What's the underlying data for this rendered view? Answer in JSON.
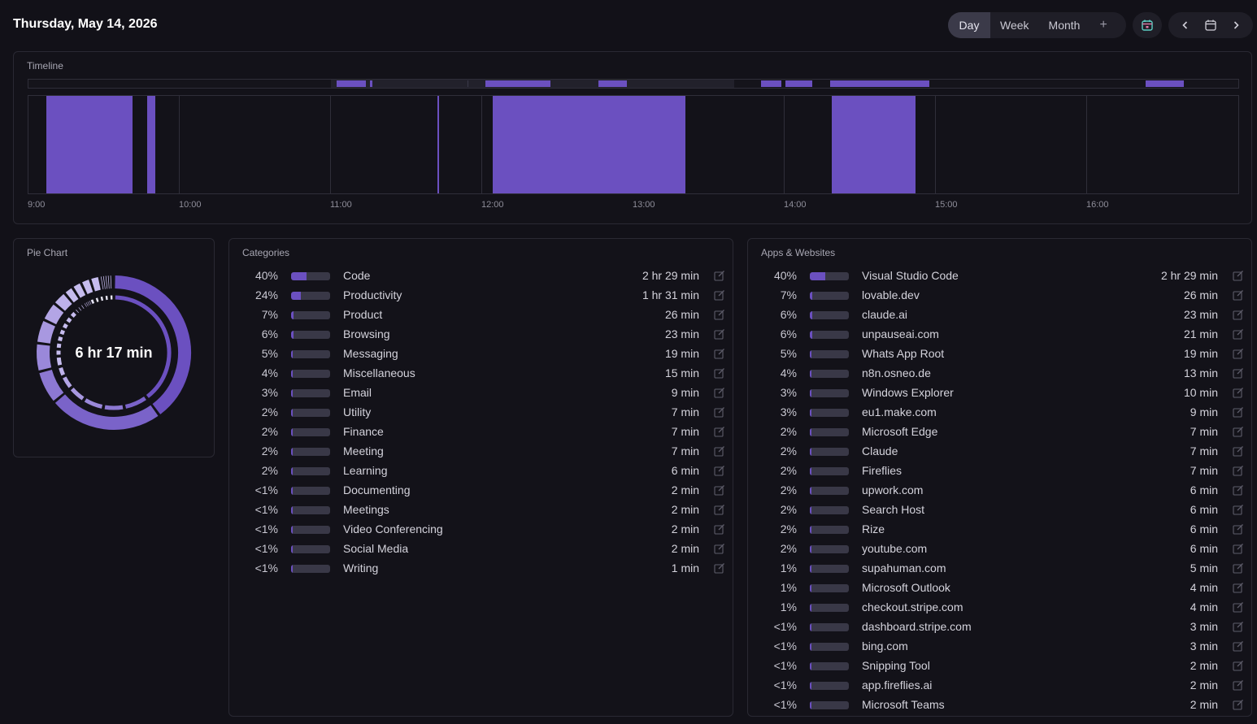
{
  "header": {
    "date": "Thursday, May 14, 2026",
    "ranges": [
      "Day",
      "Week",
      "Month"
    ],
    "active_range": "Day",
    "add_label": "+"
  },
  "colors": {
    "accent": "#6b50c0",
    "background": "#121118",
    "panel_border": "#2a2933"
  },
  "timeline": {
    "title": "Timeline",
    "ticks": [
      "9:00",
      "10:00",
      "11:00",
      "12:00",
      "13:00",
      "14:00",
      "15:00",
      "16:00"
    ]
  },
  "pie": {
    "title": "Pie Chart",
    "total": "6 hr 17 min"
  },
  "categories": {
    "title": "Categories",
    "items": [
      {
        "pct": "40%",
        "share": 0.4,
        "name": "Code",
        "duration": "2 hr 29 min"
      },
      {
        "pct": "24%",
        "share": 0.24,
        "name": "Productivity",
        "duration": "1 hr 31 min"
      },
      {
        "pct": "7%",
        "share": 0.07,
        "name": "Product",
        "duration": "26 min"
      },
      {
        "pct": "6%",
        "share": 0.06,
        "name": "Browsing",
        "duration": "23 min"
      },
      {
        "pct": "5%",
        "share": 0.05,
        "name": "Messaging",
        "duration": "19 min"
      },
      {
        "pct": "4%",
        "share": 0.04,
        "name": "Miscellaneous",
        "duration": "15 min"
      },
      {
        "pct": "3%",
        "share": 0.03,
        "name": "Email",
        "duration": "9 min"
      },
      {
        "pct": "2%",
        "share": 0.02,
        "name": "Utility",
        "duration": "7 min"
      },
      {
        "pct": "2%",
        "share": 0.02,
        "name": "Finance",
        "duration": "7 min"
      },
      {
        "pct": "2%",
        "share": 0.02,
        "name": "Meeting",
        "duration": "7 min"
      },
      {
        "pct": "2%",
        "share": 0.02,
        "name": "Learning",
        "duration": "6 min"
      },
      {
        "pct": "<1%",
        "share": 0.005,
        "name": "Documenting",
        "duration": "2 min"
      },
      {
        "pct": "<1%",
        "share": 0.005,
        "name": "Meetings",
        "duration": "2 min"
      },
      {
        "pct": "<1%",
        "share": 0.005,
        "name": "Video Conferencing",
        "duration": "2 min"
      },
      {
        "pct": "<1%",
        "share": 0.005,
        "name": "Social Media",
        "duration": "2 min"
      },
      {
        "pct": "<1%",
        "share": 0.005,
        "name": "Writing",
        "duration": "1 min"
      }
    ]
  },
  "apps": {
    "title": "Apps & Websites",
    "items": [
      {
        "pct": "40%",
        "share": 0.4,
        "name": "Visual Studio Code",
        "duration": "2 hr 29 min"
      },
      {
        "pct": "7%",
        "share": 0.07,
        "name": "lovable.dev",
        "duration": "26 min"
      },
      {
        "pct": "6%",
        "share": 0.06,
        "name": "claude.ai",
        "duration": "23 min"
      },
      {
        "pct": "6%",
        "share": 0.06,
        "name": "unpauseai.com",
        "duration": "21 min"
      },
      {
        "pct": "5%",
        "share": 0.05,
        "name": "Whats App Root",
        "duration": "19 min"
      },
      {
        "pct": "4%",
        "share": 0.04,
        "name": "n8n.osneo.de",
        "duration": "13 min"
      },
      {
        "pct": "3%",
        "share": 0.03,
        "name": "Windows Explorer",
        "duration": "10 min"
      },
      {
        "pct": "3%",
        "share": 0.03,
        "name": "eu1.make.com",
        "duration": "9 min"
      },
      {
        "pct": "2%",
        "share": 0.02,
        "name": "Microsoft Edge",
        "duration": "7 min"
      },
      {
        "pct": "2%",
        "share": 0.02,
        "name": "Claude",
        "duration": "7 min"
      },
      {
        "pct": "2%",
        "share": 0.02,
        "name": "Fireflies",
        "duration": "7 min"
      },
      {
        "pct": "2%",
        "share": 0.02,
        "name": "upwork.com",
        "duration": "6 min"
      },
      {
        "pct": "2%",
        "share": 0.02,
        "name": "Search Host",
        "duration": "6 min"
      },
      {
        "pct": "2%",
        "share": 0.02,
        "name": "Rize",
        "duration": "6 min"
      },
      {
        "pct": "2%",
        "share": 0.02,
        "name": "youtube.com",
        "duration": "6 min"
      },
      {
        "pct": "1%",
        "share": 0.01,
        "name": "supahuman.com",
        "duration": "5 min"
      },
      {
        "pct": "1%",
        "share": 0.01,
        "name": "Microsoft Outlook",
        "duration": "4 min"
      },
      {
        "pct": "1%",
        "share": 0.01,
        "name": "checkout.stripe.com",
        "duration": "4 min"
      },
      {
        "pct": "<1%",
        "share": 0.005,
        "name": "dashboard.stripe.com",
        "duration": "3 min"
      },
      {
        "pct": "<1%",
        "share": 0.005,
        "name": "bing.com",
        "duration": "3 min"
      },
      {
        "pct": "<1%",
        "share": 0.005,
        "name": "Snipping Tool",
        "duration": "2 min"
      },
      {
        "pct": "<1%",
        "share": 0.005,
        "name": "app.fireflies.ai",
        "duration": "2 min"
      },
      {
        "pct": "<1%",
        "share": 0.005,
        "name": "Microsoft Teams",
        "duration": "2 min"
      }
    ]
  }
}
